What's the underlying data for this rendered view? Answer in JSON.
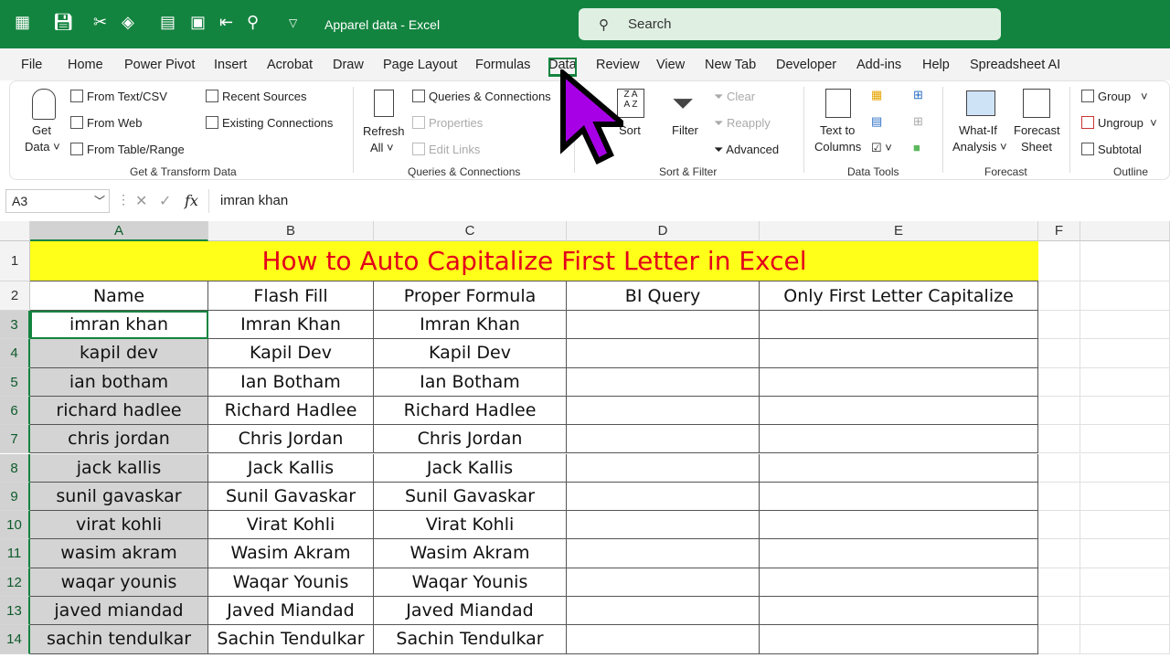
{
  "app": {
    "doc_title": "Apparel data  -  Excel",
    "search_placeholder": "Search"
  },
  "menu": [
    "File",
    "Home",
    "Power Pivot",
    "Insert",
    "Acrobat",
    "Draw",
    "Page Layout",
    "Formulas",
    "Data",
    "Review",
    "View",
    "New Tab",
    "Developer",
    "Add-ins",
    "Help",
    "Spreadsheet AI"
  ],
  "ribbon": {
    "get_transform": {
      "get_data": "Get",
      "get_data2": "Data ˅",
      "from_text": "From Text/CSV",
      "from_web": "From Web",
      "from_table": "From Table/Range",
      "recent": "Recent Sources",
      "existing": "Existing Connections",
      "label": "Get & Transform Data"
    },
    "queries": {
      "refresh": "Refresh",
      "refresh2": "All ˅",
      "qc": "Queries & Connections",
      "properties": "Properties",
      "edit_links": "Edit Links",
      "label": "Queries & Connections"
    },
    "sort_filter": {
      "sort": "Sort",
      "filter": "Filter",
      "clear": "Clear",
      "reapply": "Reapply",
      "advanced": "Advanced",
      "label": "Sort & Filter"
    },
    "data_tools": {
      "ttc": "Text to",
      "ttc2": "Columns",
      "label": "Data Tools"
    },
    "forecast": {
      "whatif": "What-If",
      "whatif2": "Analysis ˅",
      "fsheet": "Forecast",
      "fsheet2": "Sheet",
      "label": "Forecast"
    },
    "outline": {
      "group": "Group",
      "ungroup": "Ungroup",
      "subtotal": "Subtotal",
      "label": "Outline"
    }
  },
  "formula_bar": {
    "name_box": "A3",
    "formula": "imran khan"
  },
  "columns": [
    "A",
    "B",
    "C",
    "D",
    "E",
    "F"
  ],
  "title": "How to Auto Capitalize First Letter in Excel",
  "headers": [
    "Name",
    "Flash Fill",
    "Proper Formula",
    "BI Query",
    "Only First Letter Capitalize"
  ],
  "rows": [
    [
      "imran khan",
      "Imran Khan",
      "Imran Khan"
    ],
    [
      "kapil dev",
      "Kapil Dev",
      "Kapil Dev"
    ],
    [
      "ian botham",
      "Ian Botham",
      "Ian Botham"
    ],
    [
      "richard hadlee",
      "Richard Hadlee",
      "Richard Hadlee"
    ],
    [
      "chris jordan",
      "Chris Jordan",
      "Chris Jordan"
    ],
    [
      "jack kallis",
      "Jack Kallis",
      "Jack Kallis"
    ],
    [
      "sunil gavaskar",
      "Sunil Gavaskar",
      "Sunil Gavaskar"
    ],
    [
      "virat kohli",
      "Virat Kohli",
      "Virat Kohli"
    ],
    [
      "wasim akram",
      "Wasim Akram",
      "Wasim Akram"
    ],
    [
      "waqar younis",
      "Waqar Younis",
      "Waqar Younis"
    ],
    [
      "javed miandad",
      "Javed Miandad",
      "Javed Miandad"
    ],
    [
      "sachin tendulkar",
      "Sachin Tendulkar",
      "Sachin Tendulkar"
    ]
  ],
  "row_numbers": [
    "1",
    "2",
    "3",
    "4",
    "5",
    "6",
    "7",
    "8",
    "9",
    "10",
    "11",
    "12",
    "13",
    "14"
  ]
}
